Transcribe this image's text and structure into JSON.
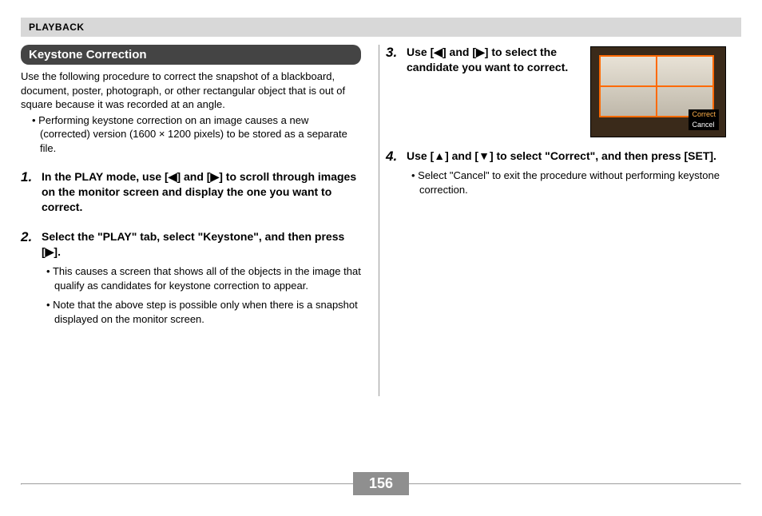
{
  "header": {
    "section": "PLAYBACK"
  },
  "left": {
    "title": "Keystone Correction",
    "intro": "Use the following procedure to correct the snapshot of a blackboard, document, poster, photograph, or other rectangular object that is out of square because it was recorded at an angle.",
    "note": "Performing keystone correction on an image causes a new (corrected) version (1600 × 1200 pixels) to be stored as a separate file.",
    "step1": {
      "num": "1.",
      "title": "In the PLAY mode, use [◀] and [▶] to scroll through images on the monitor screen and display the one you want to correct."
    },
    "step2": {
      "num": "2.",
      "title": "Select the \"PLAY\" tab, select \"Keystone\", and then press [▶].",
      "sub1": "This causes a screen that shows all of the objects in the image that qualify as candidates for keystone correction to appear.",
      "sub2": "Note that the above step is possible only when there is a snapshot displayed on the monitor screen."
    }
  },
  "right": {
    "step3": {
      "num": "3.",
      "title": "Use [◀] and [▶] to select the candidate you want to correct.",
      "menu_correct": "Correct",
      "menu_cancel": "Cancel"
    },
    "step4": {
      "num": "4.",
      "title": "Use [▲] and [▼] to select \"Correct\", and then press [SET].",
      "sub1": "Select \"Cancel\" to exit the procedure without performing keystone correction."
    }
  },
  "page_number": "156"
}
